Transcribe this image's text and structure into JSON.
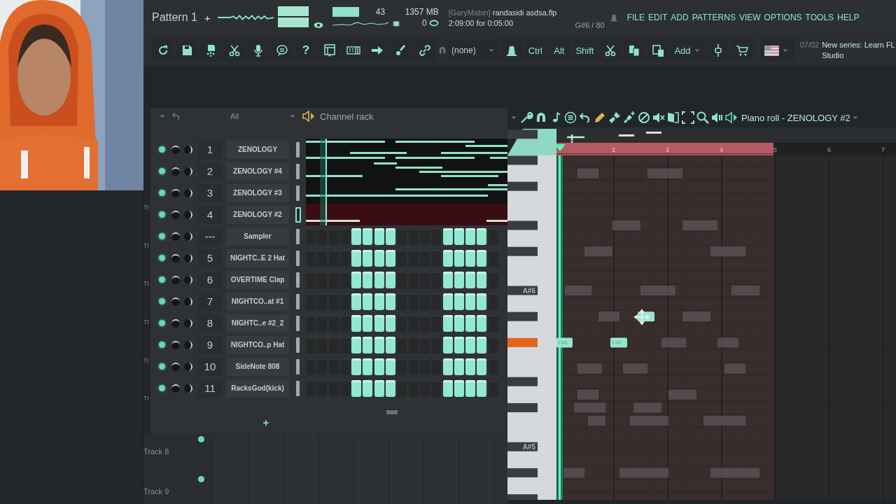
{
  "top_bar": {
    "pattern": "Pattern 1",
    "add_pattern": "+",
    "cpu": "43",
    "memory": "1357 MB",
    "polyphony": "0",
    "project_user": "[GaryMabin]",
    "project_file": "randasidi asdsa.flp",
    "song_time": "2:09:00 for 0:05:00",
    "hint": "G#6 / 80",
    "menu": [
      "FILE",
      "EDIT",
      "ADD",
      "PATTERNS",
      "VIEW",
      "OPTIONS",
      "TOOLS",
      "HELP"
    ]
  },
  "toolbar": {
    "help": "?",
    "snap": "(none)",
    "modifiers": [
      "Ctrl",
      "Alt",
      "Shift"
    ],
    "add_menu": "Add",
    "news_date": "07/02",
    "news_text": "New series: Learn FL Studio"
  },
  "channel_rack": {
    "filter": "All",
    "title": "Channel rack",
    "add_channel": "+",
    "channels": [
      {
        "number": "1",
        "name": "ZENOLOGY",
        "kind": "pianoroll",
        "on": true,
        "selected": false
      },
      {
        "number": "2",
        "name": "ZENOLOGY #4",
        "kind": "pianoroll",
        "on": true,
        "selected": false
      },
      {
        "number": "3",
        "name": "ZENOLOGY #3",
        "kind": "pianoroll",
        "on": true,
        "selected": false
      },
      {
        "number": "4",
        "name": "ZENOLOGY #2",
        "kind": "pianoroll",
        "on": true,
        "selected": true
      },
      {
        "number": "---",
        "name": "Sampler",
        "kind": "steps",
        "on": true,
        "selected": false,
        "steps": [
          false,
          false,
          false,
          false,
          true,
          true,
          true,
          true,
          false,
          false,
          false,
          false,
          true,
          true,
          true,
          true,
          false
        ]
      },
      {
        "number": "5",
        "name": "NIGHTC..E 2 Hat",
        "kind": "steps",
        "on": true,
        "selected": false,
        "steps": [
          false,
          false,
          false,
          false,
          true,
          true,
          true,
          true,
          false,
          false,
          false,
          false,
          true,
          true,
          true,
          true,
          false
        ]
      },
      {
        "number": "6",
        "name": "OVERTIME Clap",
        "kind": "steps",
        "on": true,
        "selected": false,
        "steps": [
          false,
          false,
          false,
          false,
          true,
          true,
          true,
          true,
          false,
          false,
          false,
          false,
          true,
          true,
          true,
          true,
          false
        ]
      },
      {
        "number": "7",
        "name": "NIGHTCO..at #1",
        "kind": "steps",
        "on": true,
        "selected": false,
        "steps": [
          false,
          false,
          false,
          false,
          true,
          true,
          true,
          true,
          false,
          false,
          false,
          false,
          true,
          true,
          true,
          true,
          false
        ]
      },
      {
        "number": "8",
        "name": "NIGHTC..e #2_2",
        "kind": "steps",
        "on": true,
        "selected": false,
        "steps": [
          false,
          false,
          false,
          false,
          true,
          true,
          true,
          true,
          false,
          false,
          false,
          false,
          true,
          true,
          true,
          true,
          false
        ]
      },
      {
        "number": "9",
        "name": "NIGHTCO..p Hat",
        "kind": "steps",
        "on": true,
        "selected": false,
        "steps": [
          false,
          false,
          false,
          false,
          true,
          true,
          true,
          true,
          false,
          false,
          false,
          false,
          true,
          true,
          true,
          true,
          false
        ]
      },
      {
        "number": "10",
        "name": "SideNote 808",
        "kind": "steps",
        "on": true,
        "selected": false,
        "steps": [
          false,
          false,
          false,
          false,
          true,
          true,
          true,
          true,
          false,
          false,
          false,
          false,
          true,
          true,
          true,
          true,
          false
        ]
      },
      {
        "number": "11",
        "name": "RacksGod(kick)",
        "kind": "steps",
        "on": true,
        "selected": false,
        "steps": [
          false,
          false,
          false,
          false,
          true,
          true,
          true,
          true,
          false,
          false,
          false,
          false,
          true,
          true,
          true,
          true,
          false
        ]
      }
    ]
  },
  "piano_roll": {
    "title": "Piano roll - ZENOLOGY #2",
    "bar_numbers": [
      "2",
      "3",
      "4",
      "5",
      "6",
      "7"
    ],
    "key_labels": [
      "A#6",
      "A#5"
    ],
    "notes": [
      {
        "label": "F#6"
      },
      {
        "label": "F#6"
      }
    ]
  },
  "playlist": {
    "side_labels": [
      "Tr",
      "Tr",
      "Tr",
      "Tr",
      "Tr",
      "Tr"
    ],
    "tracks": [
      "Track 8",
      "Track 9"
    ]
  }
}
